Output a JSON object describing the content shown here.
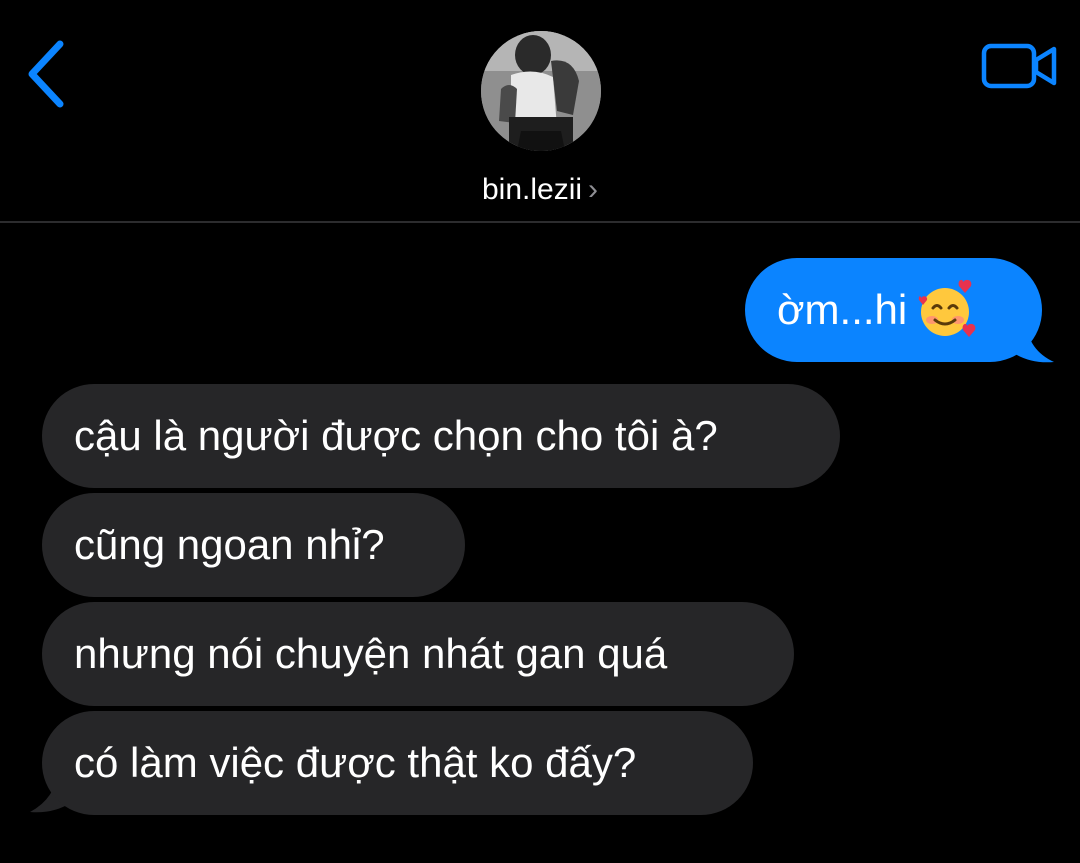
{
  "header": {
    "contact_name": "bin.lezii",
    "back_icon": "chevron-left-icon",
    "video_icon": "video-camera-icon",
    "disclosure_icon": "chevron-right-icon",
    "disclosure_glyph": "›"
  },
  "colors": {
    "background": "#000000",
    "accent": "#0b84ff",
    "sent_bubble": "#0b84ff",
    "received_bubble": "#262628",
    "divider": "#2c2c2e"
  },
  "messages": [
    {
      "direction": "sent",
      "text": "ờm...hi",
      "emoji": "smiling-face-with-hearts-icon"
    },
    {
      "direction": "received",
      "text": "cậu là người được chọn cho tôi à?"
    },
    {
      "direction": "received",
      "text": "cũng ngoan nhỉ?"
    },
    {
      "direction": "received",
      "text": "nhưng nói chuyện nhát gan quá"
    },
    {
      "direction": "received",
      "text": "có làm việc được thật ko đấy?"
    }
  ]
}
